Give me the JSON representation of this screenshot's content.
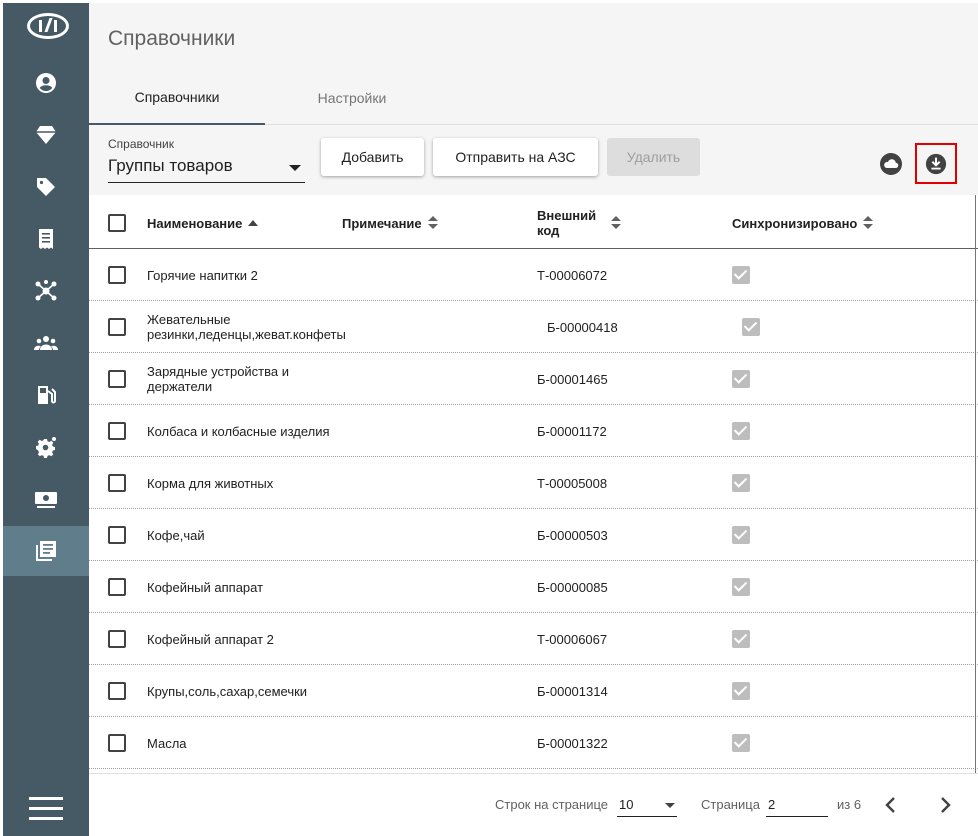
{
  "page": {
    "title": "Справочники"
  },
  "tabs": [
    {
      "label": "Справочники",
      "active": true
    },
    {
      "label": "Настройки",
      "active": false
    }
  ],
  "toolbar": {
    "select_label": "Справочник",
    "select_value": "Группы товаров",
    "add_label": "Добавить",
    "send_label": "Отправить на АЗС",
    "delete_label": "Удалить"
  },
  "sidebar": {
    "items": [
      {
        "icon": "account-icon"
      },
      {
        "icon": "diamond-icon"
      },
      {
        "icon": "tag-icon"
      },
      {
        "icon": "receipt-icon"
      },
      {
        "icon": "network-icon"
      },
      {
        "icon": "users-group-icon"
      },
      {
        "icon": "fuel-station-icon"
      },
      {
        "icon": "settings-gear-icon"
      },
      {
        "icon": "money-icon"
      },
      {
        "icon": "library-books-icon",
        "active": true
      }
    ]
  },
  "table": {
    "headers": {
      "name": "Наименование",
      "note": "Примечание",
      "ext_code": "Внешний код",
      "sync": "Синхронизировано"
    },
    "rows": [
      {
        "name": "Горячие напитки 2",
        "code": "Т-00006072",
        "synced": true
      },
      {
        "name": "Жевательные резинки,леденцы,жеват.конфеты",
        "code": "Б-00000418",
        "synced": true
      },
      {
        "name": "Зарядные устройства и держатели",
        "code": "Б-00001465",
        "synced": true
      },
      {
        "name": "Колбаса и колбасные изделия",
        "code": "Б-00001172",
        "synced": true
      },
      {
        "name": "Корма для животных",
        "code": "Т-00005008",
        "synced": true
      },
      {
        "name": "Кофе,чай",
        "code": "Б-00000503",
        "synced": true
      },
      {
        "name": "Кофейный аппарат",
        "code": "Б-00000085",
        "synced": true
      },
      {
        "name": "Кофейный аппарат 2",
        "code": "Т-00006067",
        "synced": true
      },
      {
        "name": "Крупы,соль,сахар,семечки",
        "code": "Б-00001314",
        "synced": true
      },
      {
        "name": "Масла",
        "code": "Б-00001322",
        "synced": true
      }
    ]
  },
  "footer": {
    "rows_per_page_label": "Строк на странице",
    "rows_per_page_value": "10",
    "page_label": "Страница",
    "page_value": "2",
    "of_label": "из 6"
  },
  "colors": {
    "sidebar": "#455a64",
    "sidebar_active": "#607d8b",
    "highlight_border": "#e00000"
  }
}
